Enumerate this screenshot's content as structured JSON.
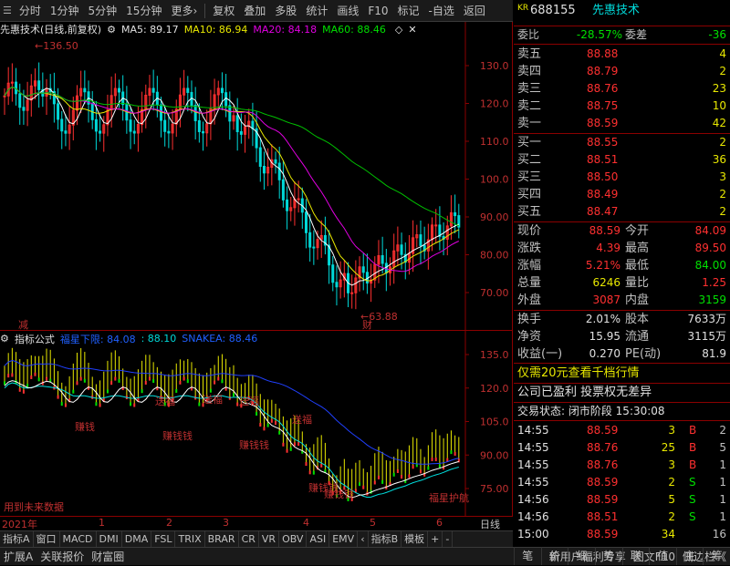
{
  "toolbar": {
    "items": [
      "分时",
      "1分钟",
      "5分钟",
      "15分钟",
      "更多›",
      "复权",
      "叠加",
      "多股",
      "统计",
      "画线",
      "F10",
      "标记",
      "-自选",
      "返回"
    ]
  },
  "main": {
    "title": "先惠技术(日线,前复权)",
    "ma5": "MA5: 89.17",
    "ma10": "MA10: 86.94",
    "ma20": "MA20: 84.18",
    "ma60": "MA60: 88.46",
    "high_label": "136.50",
    "low_label": "63.88",
    "reduce_label": "减",
    "fin_label": "财",
    "y_ticks": [
      "130.0",
      "120.0",
      "110.0",
      "100.0",
      "90.00",
      "80.00",
      "70.00"
    ]
  },
  "sub": {
    "title": "指标公式",
    "line1": "福星下限: 84.08",
    "line2": ": 88.10",
    "line3": "SNAKEA: 88.46",
    "y_ticks": [
      "135.0",
      "120.0",
      "105.0",
      "90.00",
      "75.00"
    ],
    "future_note": "用到未来数据",
    "labels": [
      "送福",
      "送福",
      "送福",
      "送福",
      "赚钱",
      "赚钱钱",
      "赚钱钱",
      "赚钱钱",
      "赚钱钱",
      "福星护航"
    ]
  },
  "date_axis": {
    "year": "2021年",
    "months": [
      "1",
      "2",
      "3",
      "4",
      "5",
      "6"
    ],
    "right_label": "日线"
  },
  "indicator_tabs": [
    "指标A",
    "窗口",
    "MACD",
    "DMI",
    "DMA",
    "FSL",
    "TRIX",
    "BRAR",
    "CR",
    "VR",
    "OBV",
    "ASI",
    "EMV",
    "‹",
    "指标B",
    "模板",
    "+",
    "-"
  ],
  "bottom_bar": {
    "left": [
      "扩展A",
      "关联报价",
      "财富圈"
    ],
    "right": [
      "新用户福利专享",
      "图文F10",
      "侧边栏《"
    ]
  },
  "quote": {
    "code": "688155",
    "name": "先惠技术",
    "kr": "KR",
    "weibi_label": "委比",
    "weibi": "-28.57%",
    "weicha_label": "委差",
    "weicha": "-36",
    "asks": [
      {
        "label": "卖五",
        "price": "88.88",
        "vol": "4"
      },
      {
        "label": "卖四",
        "price": "88.79",
        "vol": "2"
      },
      {
        "label": "卖三",
        "price": "88.76",
        "vol": "23"
      },
      {
        "label": "卖二",
        "price": "88.75",
        "vol": "10"
      },
      {
        "label": "卖一",
        "price": "88.59",
        "vol": "42"
      }
    ],
    "bids": [
      {
        "label": "买一",
        "price": "88.55",
        "vol": "2"
      },
      {
        "label": "买二",
        "price": "88.51",
        "vol": "36"
      },
      {
        "label": "买三",
        "price": "88.50",
        "vol": "3"
      },
      {
        "label": "买四",
        "price": "88.49",
        "vol": "2"
      },
      {
        "label": "买五",
        "price": "88.47",
        "vol": "2"
      }
    ],
    "stats": [
      {
        "l1": "现价",
        "v1": "88.59",
        "l2": "今开",
        "v2": "84.09"
      },
      {
        "l1": "涨跌",
        "v1": "4.39",
        "l2": "最高",
        "v2": "89.50"
      },
      {
        "l1": "涨幅",
        "v1": "5.21%",
        "l2": "最低",
        "v2": "84.00"
      },
      {
        "l1": "总量",
        "v1": "6246",
        "l2": "量比",
        "v2": "1.25"
      },
      {
        "l1": "外盘",
        "v1": "3087",
        "l2": "内盘",
        "v2": "3159"
      }
    ],
    "stats2": [
      {
        "l1": "换手",
        "v1": "2.01%",
        "l2": "股本",
        "v2": "7633万"
      },
      {
        "l1": "净资",
        "v1": "15.95",
        "l2": "流通",
        "v2": "3115万"
      },
      {
        "l1": "收益(一)",
        "v1": "0.270",
        "l2": "PE(动)",
        "v2": "81.9"
      }
    ],
    "promo": "仅需20元查看千档行情",
    "info": "公司已盈利 投票权无差异",
    "trade_status": "交易状态: 闭市阶段 15:30:08",
    "ticks": [
      {
        "time": "14:55",
        "price": "88.59",
        "vol": "3",
        "side": "B"
      },
      {
        "time": "14:55",
        "price": "88.76",
        "vol": "25",
        "side": "B"
      },
      {
        "time": "14:55",
        "price": "88.76",
        "vol": "3",
        "side": "B"
      },
      {
        "time": "14:55",
        "price": "88.59",
        "vol": "2",
        "side": "S"
      },
      {
        "time": "14:56",
        "price": "88.59",
        "vol": "5",
        "side": "S"
      },
      {
        "time": "14:56",
        "price": "88.51",
        "vol": "2",
        "side": "S"
      },
      {
        "time": "15:00",
        "price": "88.59",
        "vol": "34",
        "side": "16"
      }
    ],
    "tick_tail": [
      "2",
      "5",
      "1",
      "1",
      "1",
      "1",
      "16"
    ]
  },
  "right_tabs": [
    "笔",
    "价",
    "细",
    "势",
    "联",
    "值",
    "主",
    "筹"
  ],
  "colors": {
    "up": "#ff3030",
    "down": "#00d8d8",
    "ma5": "#ffffff",
    "ma10": "#e8e800",
    "ma20": "#e000e0",
    "ma60": "#00c000",
    "axis": "#8b0000"
  }
}
